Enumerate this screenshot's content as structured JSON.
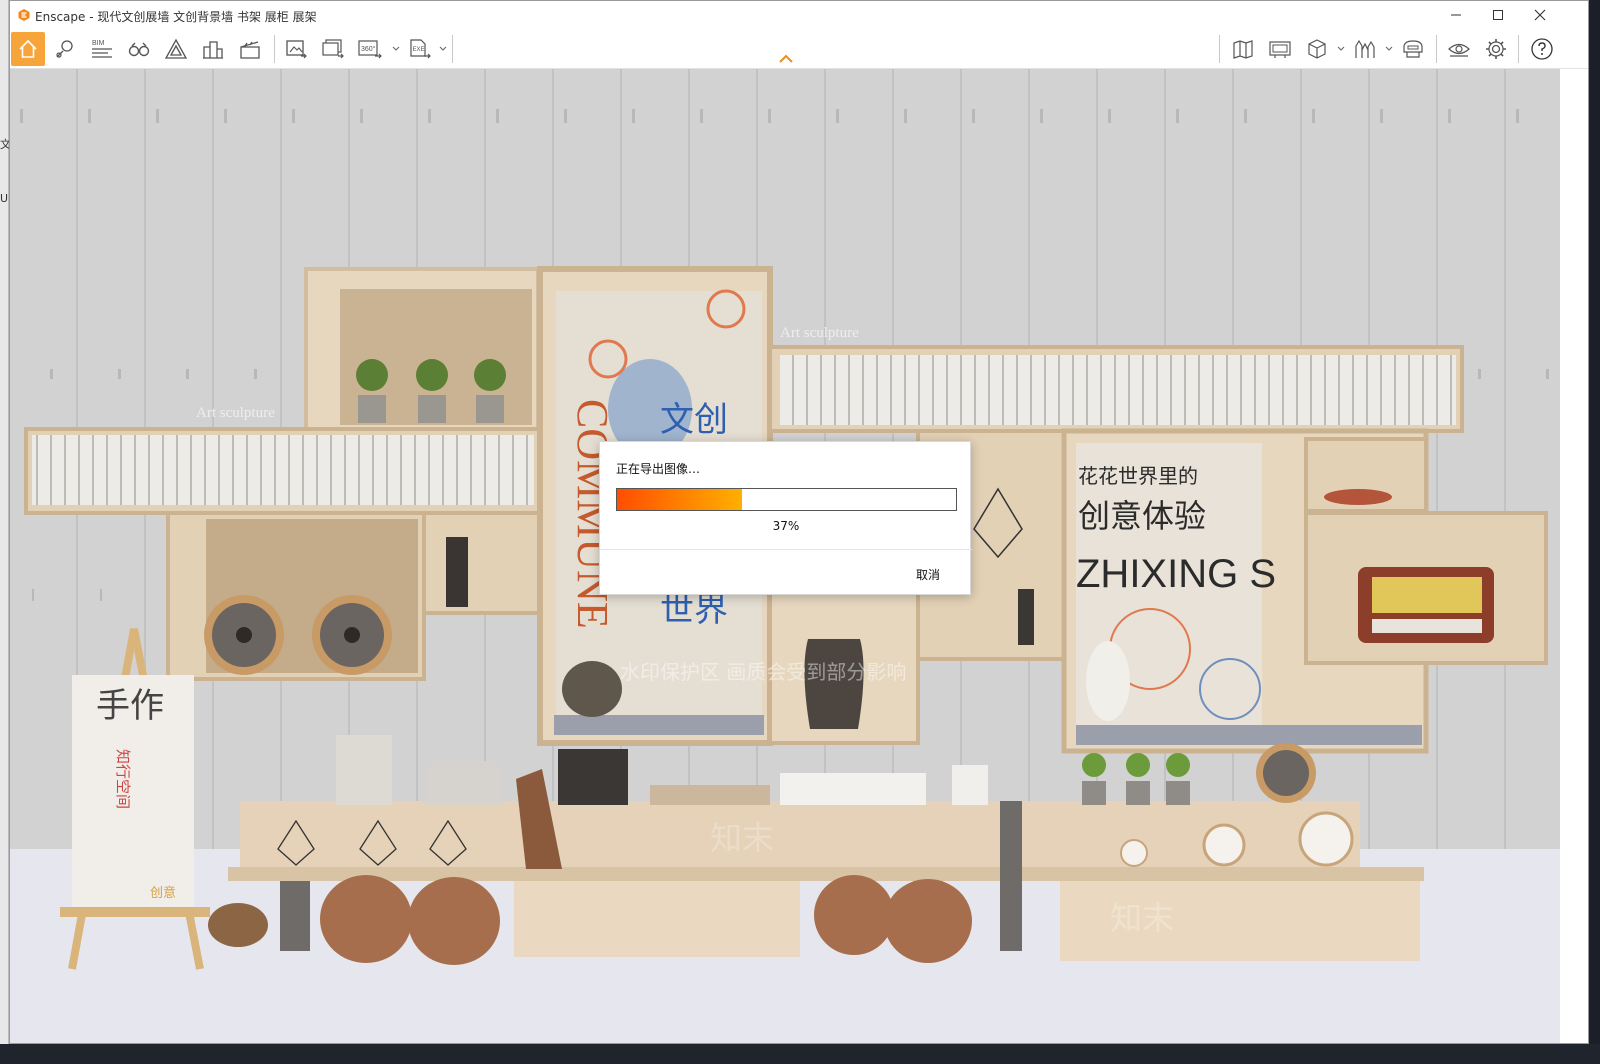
{
  "window": {
    "title": "Enscape - 现代文创展墙 文创背景墙 书架 展柜 展架",
    "accent_color": "#f7a43a",
    "controls": [
      "minimize-icon",
      "maximize-icon",
      "close-icon"
    ]
  },
  "background_window": {
    "edge_text_1": "文",
    "edge_text_2": "U"
  },
  "toolbar": {
    "bim_label": "BIM",
    "left_buttons": [
      "home-icon",
      "map-pin-icon",
      "bim-list-icon",
      "binoculars-icon",
      "triangle-icon",
      "buildings-icon",
      "clapper-icon"
    ],
    "export_buttons": [
      "screenshot-icon",
      "batch-render-icon",
      "panorama-360-icon",
      "exe-export-icon"
    ],
    "panorama_label": "360°",
    "exe_label": "EXE",
    "right_buttons": [
      "map-icon",
      "billboard-icon",
      "cube-icon",
      "forest-icon",
      "helmet-icon",
      "eye-icon",
      "gear-icon",
      "help-icon"
    ]
  },
  "scene": {
    "wall_sign_1": "Art sculpture",
    "wall_sign_2": "Art sculpture",
    "poster_1_vertical": "COMMUNE",
    "poster_1_cn_top": "文创",
    "poster_1_cn_bottom": "世界",
    "poster_2_line1": "花花世界里的",
    "poster_2_line2": "创意体验",
    "poster_2_line3": "ZHIXING S",
    "easel_title": "手作",
    "easel_sub": "知行空间",
    "easel_foot": "创意",
    "watermark": "水印保护区   画质会受到部分影响",
    "watermark_small": "知末"
  },
  "dialog": {
    "title": "正在导出图像…",
    "progress": 0.37,
    "progress_text": "37%",
    "cancel_label": "取消"
  }
}
